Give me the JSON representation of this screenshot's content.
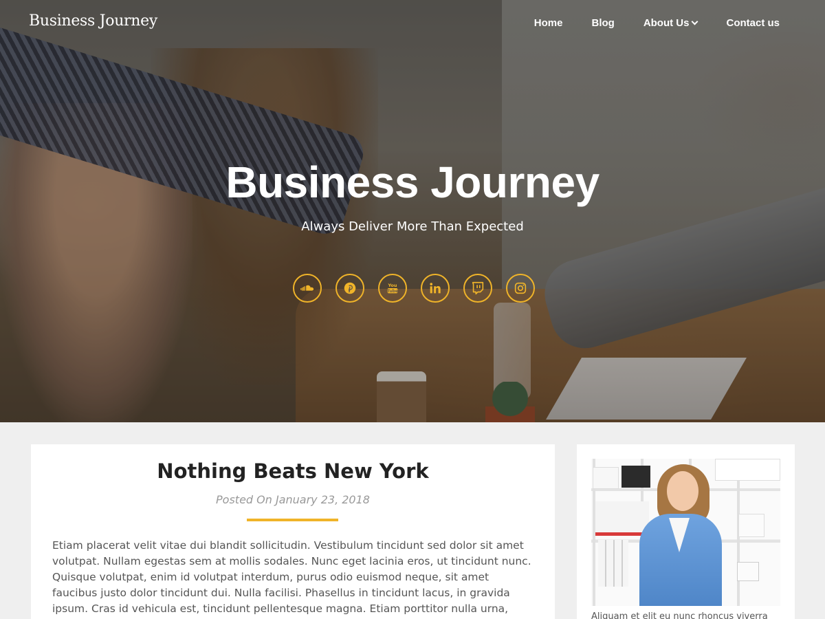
{
  "site": {
    "logo": "Business Journey"
  },
  "nav": {
    "items": [
      {
        "label": "Home"
      },
      {
        "label": "Blog"
      },
      {
        "label": "About Us",
        "has_dropdown": true
      },
      {
        "label": "Contact us"
      }
    ]
  },
  "hero": {
    "title": "Business Journey",
    "tagline": "Always Deliver More Than Expected",
    "social": [
      {
        "icon": "soundcloud-icon"
      },
      {
        "icon": "pinterest-icon"
      },
      {
        "icon": "youtube-icon"
      },
      {
        "icon": "linkedin-icon"
      },
      {
        "icon": "twitch-icon"
      },
      {
        "icon": "instagram-icon"
      }
    ]
  },
  "post": {
    "title": "Nothing Beats New York",
    "meta": "Posted On January 23, 2018",
    "excerpt": "Etiam placerat velit vitae dui blandit sollicitudin. Vestibulum tincidunt sed dolor sit amet volutpat. Nullam egestas sem at mollis sodales. Nunc eget lacinia eros, ut tincidunt nunc. Quisque volutpat, enim id volutpat interdum, purus odio euismod neque, sit amet faucibus justo dolor tincidunt dui. Nulla facilisi. Phasellus in tincidunt lacus, in gravida ipsum. Cras id vehicula est, tincidunt pellentesque magna. Etiam porttitor nulla urna, quis vulputate justo"
  },
  "sidebar": {
    "caption": "Aliquam et elit eu nunc rhoncus viverra"
  },
  "colors": {
    "accent": "#f0b429",
    "page_bg": "#efefef",
    "card_bg": "#ffffff",
    "title_text": "#222222",
    "meta_text": "#999999",
    "body_text": "#555555"
  }
}
